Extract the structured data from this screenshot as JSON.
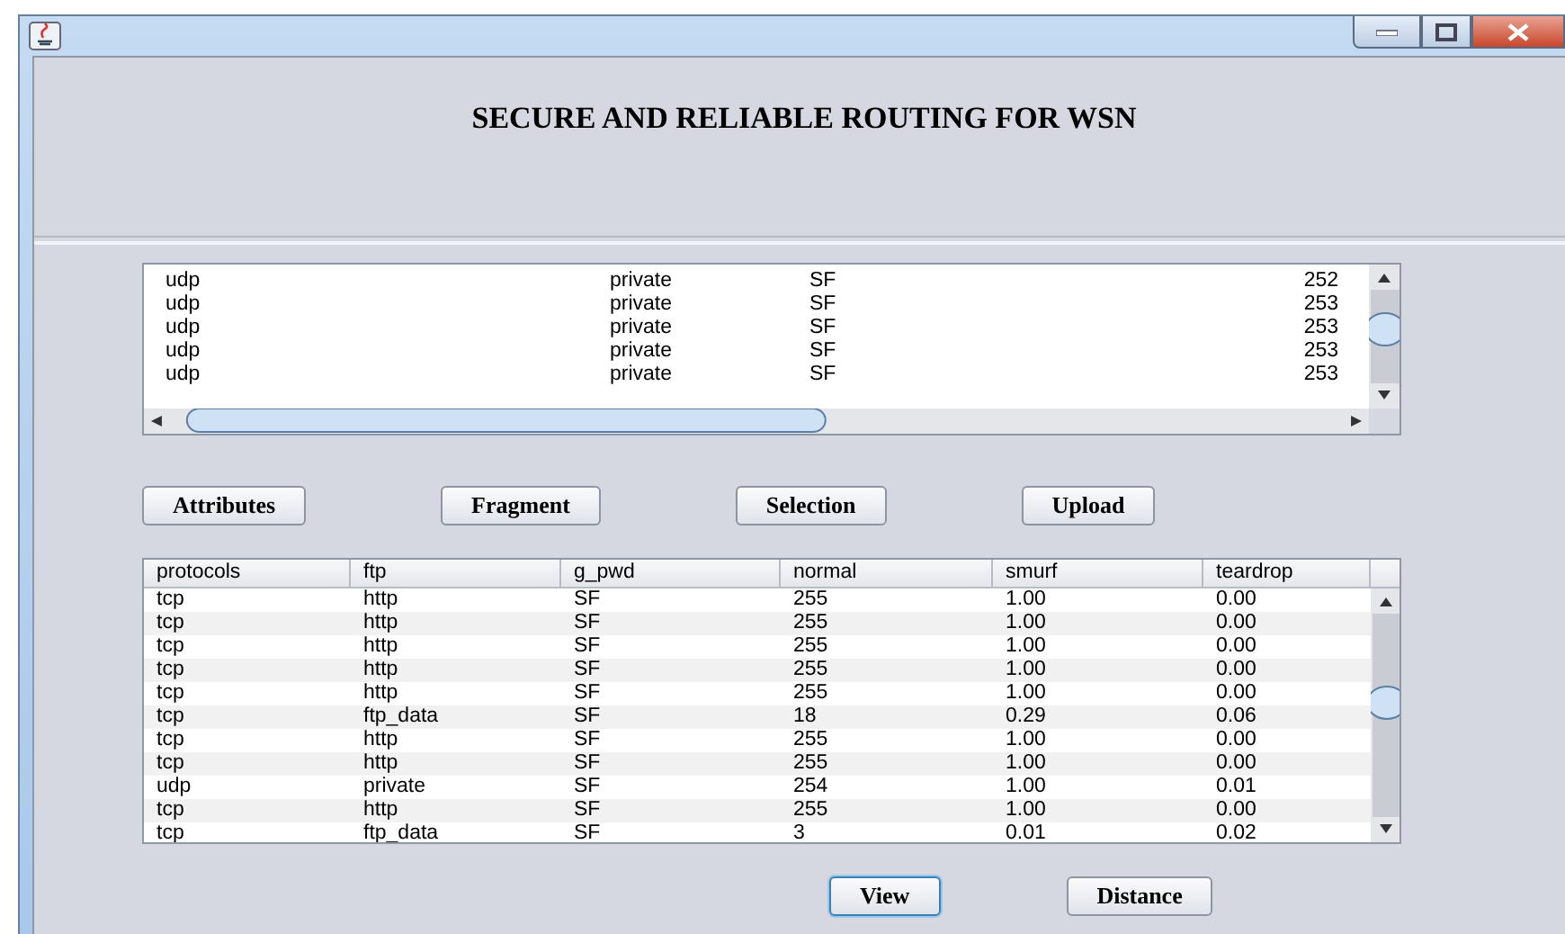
{
  "header": {
    "title": "SECURE AND RELIABLE ROUTING FOR WSN"
  },
  "records": {
    "rows": [
      [
        "udp",
        "private",
        "SF",
        "252"
      ],
      [
        "udp",
        "private",
        "SF",
        "253"
      ],
      [
        "udp",
        "private",
        "SF",
        "253"
      ],
      [
        "udp",
        "private",
        "SF",
        "253"
      ],
      [
        "udp",
        "private",
        "SF",
        "253"
      ]
    ]
  },
  "actions": [
    {
      "label": "Attributes"
    },
    {
      "label": "Fragment"
    },
    {
      "label": "Selection"
    },
    {
      "label": "Upload"
    }
  ],
  "table": {
    "columns": [
      "protocols",
      "ftp",
      "g_pwd",
      "normal",
      "smurf",
      "teardrop"
    ],
    "rows": [
      [
        "tcp",
        "http",
        "SF",
        "255",
        "1.00",
        "0.00"
      ],
      [
        "tcp",
        "http",
        "SF",
        "255",
        "1.00",
        "0.00"
      ],
      [
        "tcp",
        "http",
        "SF",
        "255",
        "1.00",
        "0.00"
      ],
      [
        "tcp",
        "http",
        "SF",
        "255",
        "1.00",
        "0.00"
      ],
      [
        "tcp",
        "http",
        "SF",
        "255",
        "1.00",
        "0.00"
      ],
      [
        "tcp",
        "ftp_data",
        "SF",
        "18",
        "0.29",
        "0.06"
      ],
      [
        "tcp",
        "http",
        "SF",
        "255",
        "1.00",
        "0.00"
      ],
      [
        "tcp",
        "http",
        "SF",
        "255",
        "1.00",
        "0.00"
      ],
      [
        "udp",
        "private",
        "SF",
        "254",
        "1.00",
        "0.01"
      ],
      [
        "tcp",
        "http",
        "SF",
        "255",
        "1.00",
        "0.00"
      ],
      [
        "tcp",
        "ftp_data",
        "SF",
        "3",
        "0.01",
        "0.02"
      ]
    ]
  },
  "bottom_actions": [
    {
      "label": "View",
      "focused": true
    },
    {
      "label": "Distance",
      "focused": false
    }
  ]
}
